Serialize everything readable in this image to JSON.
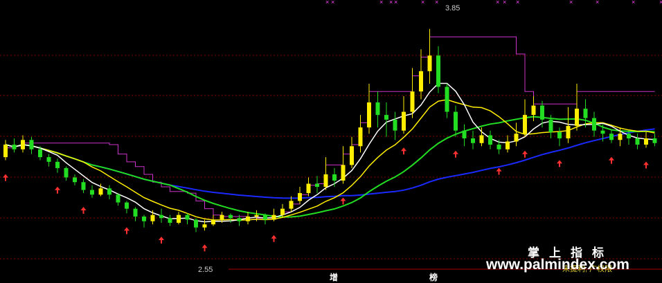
{
  "chart_data": {
    "type": "candlestick",
    "title": "",
    "xlabel": "",
    "ylabel": "",
    "ylim": [
      2.3,
      4.0
    ],
    "high_label": "3.85",
    "low_label": "2.55",
    "grid": "dashed-red-horizontal",
    "bottom_labels": [
      "增",
      "榜"
    ],
    "watermark_bottom": "宋提利, 广权限",
    "watermark_title": "掌上指标",
    "watermark_url": "www.palmindex.com",
    "colors": {
      "up": "#ffee00",
      "down": "#22dd22",
      "ma_short": "#ffffff",
      "ma_mid": "#ffee00",
      "ma_long": "#22dd22",
      "ma_trend": "#1a2aff",
      "step_line": "#cc33cc",
      "grid": "#8a0000",
      "arrow": "#ff3030"
    },
    "candles": [
      [
        3.03,
        3.11,
        3.01,
        3.14
      ],
      [
        3.11,
        3.08,
        3.06,
        3.15
      ],
      [
        3.08,
        3.14,
        3.06,
        3.17
      ],
      [
        3.14,
        3.08,
        3.05,
        3.16
      ],
      [
        3.08,
        3.03,
        3.01,
        3.1
      ],
      [
        3.03,
        3.0,
        2.97,
        3.05
      ],
      [
        3.0,
        2.96,
        2.93,
        3.02
      ],
      [
        2.96,
        2.9,
        2.88,
        2.97
      ],
      [
        2.9,
        2.87,
        2.85,
        2.92
      ],
      [
        2.87,
        2.82,
        2.8,
        2.89
      ],
      [
        2.82,
        2.79,
        2.77,
        2.85
      ],
      [
        2.79,
        2.83,
        2.78,
        2.86
      ],
      [
        2.83,
        2.79,
        2.76,
        2.85
      ],
      [
        2.79,
        2.74,
        2.72,
        2.8
      ],
      [
        2.74,
        2.7,
        2.67,
        2.75
      ],
      [
        2.7,
        2.65,
        2.62,
        2.71
      ],
      [
        2.65,
        2.62,
        2.58,
        2.66
      ],
      [
        2.62,
        2.66,
        2.6,
        2.69
      ],
      [
        2.66,
        2.64,
        2.61,
        2.7
      ],
      [
        2.64,
        2.61,
        2.59,
        2.66
      ],
      [
        2.61,
        2.66,
        2.6,
        2.68
      ],
      [
        2.66,
        2.63,
        2.6,
        2.67
      ],
      [
        2.63,
        2.58,
        2.55,
        2.64
      ],
      [
        2.58,
        2.6,
        2.56,
        2.63
      ],
      [
        2.6,
        2.63,
        2.59,
        2.66
      ],
      [
        2.63,
        2.66,
        2.61,
        2.68
      ],
      [
        2.66,
        2.64,
        2.61,
        2.67
      ],
      [
        2.64,
        2.62,
        2.59,
        2.66
      ],
      [
        2.62,
        2.65,
        2.6,
        2.68
      ],
      [
        2.65,
        2.66,
        2.62,
        2.69
      ],
      [
        2.66,
        2.63,
        2.6,
        2.67
      ],
      [
        2.63,
        2.66,
        2.62,
        2.7
      ],
      [
        2.66,
        2.7,
        2.65,
        2.73
      ],
      [
        2.7,
        2.75,
        2.68,
        2.78
      ],
      [
        2.75,
        2.8,
        2.73,
        2.84
      ],
      [
        2.8,
        2.86,
        2.78,
        2.9
      ],
      [
        2.86,
        2.84,
        2.8,
        2.91
      ],
      [
        2.84,
        2.92,
        2.82,
        3.03
      ],
      [
        2.92,
        2.88,
        2.84,
        2.96
      ],
      [
        2.88,
        2.98,
        2.86,
        3.1
      ],
      [
        2.98,
        3.1,
        2.96,
        3.16
      ],
      [
        3.1,
        3.22,
        3.06,
        3.3
      ],
      [
        3.22,
        3.38,
        3.18,
        3.5
      ],
      [
        3.38,
        3.3,
        3.22,
        3.45
      ],
      [
        3.3,
        3.27,
        3.16,
        3.38
      ],
      [
        3.27,
        3.2,
        3.14,
        3.32
      ],
      [
        3.2,
        3.32,
        3.18,
        3.42
      ],
      [
        3.32,
        3.45,
        3.28,
        3.6
      ],
      [
        3.45,
        3.58,
        3.4,
        3.72
      ],
      [
        3.58,
        3.68,
        3.5,
        3.85
      ],
      [
        3.68,
        3.48,
        3.44,
        3.74
      ],
      [
        3.48,
        3.32,
        3.28,
        3.5
      ],
      [
        3.32,
        3.2,
        3.16,
        3.36
      ],
      [
        3.2,
        3.15,
        3.1,
        3.24
      ],
      [
        3.15,
        3.12,
        3.08,
        3.2
      ],
      [
        3.12,
        3.17,
        3.1,
        3.22
      ],
      [
        3.17,
        3.11,
        3.08,
        3.2
      ],
      [
        3.11,
        3.08,
        3.05,
        3.14
      ],
      [
        3.08,
        3.13,
        3.06,
        3.17
      ],
      [
        3.13,
        3.18,
        3.1,
        3.25
      ],
      [
        3.18,
        3.3,
        3.16,
        3.4
      ],
      [
        3.3,
        3.36,
        3.26,
        3.42
      ],
      [
        3.36,
        3.27,
        3.22,
        3.39
      ],
      [
        3.27,
        3.19,
        3.15,
        3.3
      ],
      [
        3.19,
        3.15,
        3.1,
        3.22
      ],
      [
        3.15,
        3.23,
        3.12,
        3.35
      ],
      [
        3.23,
        3.34,
        3.2,
        3.5
      ],
      [
        3.34,
        3.28,
        3.22,
        3.4
      ],
      [
        3.28,
        3.2,
        3.16,
        3.32
      ],
      [
        3.2,
        3.18,
        3.13,
        3.24
      ],
      [
        3.18,
        3.14,
        3.12,
        3.21
      ],
      [
        3.14,
        3.18,
        3.1,
        3.22
      ],
      [
        3.18,
        3.15,
        3.11,
        3.2
      ],
      [
        3.15,
        3.11,
        3.08,
        3.18
      ],
      [
        3.11,
        3.15,
        3.09,
        3.19
      ],
      [
        3.15,
        3.12,
        3.1,
        3.18
      ]
    ]
  }
}
